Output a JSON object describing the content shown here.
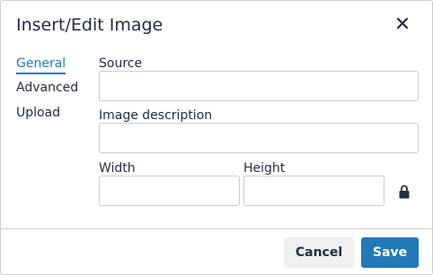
{
  "dialog": {
    "title": "Insert/Edit Image",
    "close_icon": "close-icon"
  },
  "nav": {
    "active": "General",
    "items": [
      {
        "label": "General"
      },
      {
        "label": "Advanced"
      },
      {
        "label": "Upload"
      }
    ]
  },
  "form": {
    "source_label": "Source",
    "source_value": "",
    "description_label": "Image description",
    "description_value": "",
    "width_label": "Width",
    "width_value": "",
    "height_label": "Height",
    "height_value": "",
    "lock_icon": "lock-icon"
  },
  "footer": {
    "cancel_label": "Cancel",
    "save_label": "Save"
  },
  "colors": {
    "accent": "#207ab7",
    "text": "#222f3e",
    "border": "#cccccc",
    "secondary_button_bg": "#f0f0f0"
  }
}
